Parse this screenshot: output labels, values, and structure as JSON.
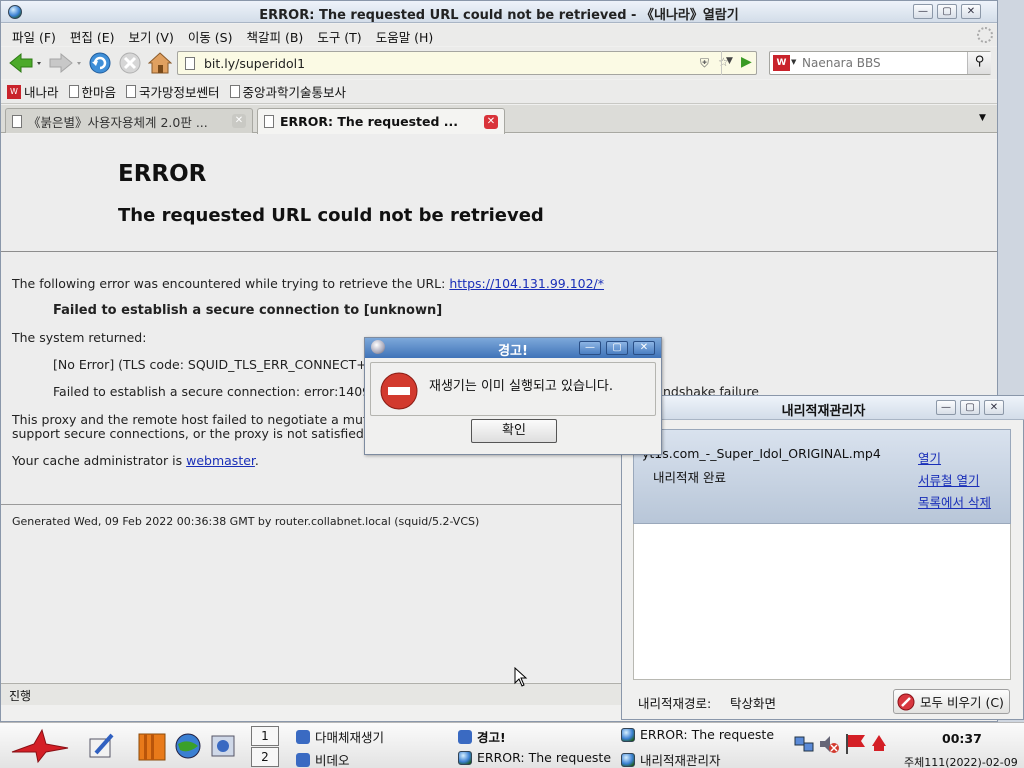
{
  "browser": {
    "title": "ERROR: The requested URL could not be retrieved - 《내나라》열람기",
    "menu": [
      "파일 (F)",
      "편집 (E)",
      "보기 (V)",
      "이동 (S)",
      "책갈피 (B)",
      "도구 (T)",
      "도움말 (H)"
    ],
    "url": "bit.ly/superidol1",
    "search_placeholder": "Naenara BBS",
    "bookmarks": [
      "내나라",
      "한마음",
      "국가망정보쎈터",
      "중앙과학기술통보사"
    ],
    "tabs": [
      {
        "label": "《붉은별》사용자용체계 2.0판 ...",
        "active": false
      },
      {
        "label": "ERROR: The requested ...",
        "active": true
      }
    ],
    "status": "진행"
  },
  "page": {
    "heading": "ERROR",
    "subheading": "The requested URL could not be retrieved",
    "intro": "The following error was encountered while trying to retrieve the URL: ",
    "intro_link": "https://104.131.99.102/*",
    "failed": "Failed to establish a secure connection to [unknown]",
    "system_returned": "The system returned:",
    "no_error": "[No Error] (TLS code: SQUID_TLS_ERR_CONNECT+TL",
    "failed_detail": "Failed to establish a secure connection: error:1409",
    "failed_detail_tail": "ndshake failure",
    "proxy_line1": "This proxy and the remote host failed to negotiate a mutua",
    "proxy_line2": "support secure connections, or the proxy is not satisfied",
    "cache_admin": "Your cache administrator is ",
    "cache_admin_link": "webmaster",
    "cache_admin_end": ".",
    "generated": "Generated Wed, 09 Feb 2022 00:36:38 GMT by router.collabnet.local (squid/5.2-VCS)"
  },
  "alert": {
    "title": "경고!",
    "message": "재생기는 이미 실행되고 있습니다.",
    "ok": "확인"
  },
  "download_manager": {
    "title": "내리적재관리자",
    "filename": "yt1s.com_-_Super_Idol_ORIGINAL.mp4",
    "status": "내리적재 완료",
    "open": "열기",
    "open_folder": "서류철 열기",
    "remove": "목록에서 삭제",
    "path_label": "내리적재경로:",
    "path_value": "탁상화면",
    "clear_all": "모두 비우기 (C)"
  },
  "taskbar": {
    "pages": [
      "1",
      "2"
    ],
    "items": [
      "다매체재생기",
      "비데오",
      "경고!",
      "ERROR: The requeste",
      "ERROR: The requeste",
      "내리적재관리자"
    ],
    "time": "00:37",
    "date": "주체111(2022)-02-09"
  }
}
